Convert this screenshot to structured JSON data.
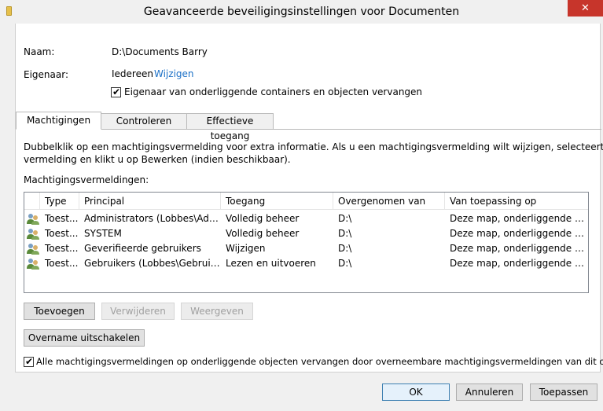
{
  "window": {
    "title": "Geavanceerde beveiligingsinstellingen voor Documenten",
    "close_label": "✕"
  },
  "owner": {
    "name_label": "Naam:",
    "name_value": "D:\\Documents Barry",
    "owner_label": "Eigenaar:",
    "owner_value": "Iedereen",
    "change_link": "Wijzigen",
    "replace_owner_label": "Eigenaar van onderliggende containers en objecten vervangen",
    "replace_owner_checked": true
  },
  "tabs": [
    {
      "label": "Machtigingen",
      "active": true
    },
    {
      "label": "Controleren",
      "active": false
    },
    {
      "label": "Effectieve toegang",
      "active": false
    }
  ],
  "permissions": {
    "instructions_line1": "Dubbelklik op een machtigingsvermelding voor extra informatie. Als u een machtigingsvermelding wilt wijzigen, selecteert u de",
    "instructions_line2": "vermelding en klikt u op Bewerken (indien beschikbaar).",
    "entries_label": "Machtigingsvermeldingen:",
    "columns": [
      "Type",
      "Principal",
      "Toegang",
      "Overgenomen van",
      "Van toepassing op"
    ],
    "rows": [
      {
        "type": "Toest...",
        "principal": "Administrators (Lobbes\\Admi...",
        "access": "Volledig beheer",
        "inherited": "D:\\",
        "applies": "Deze map, onderliggende map..."
      },
      {
        "type": "Toest...",
        "principal": "SYSTEM",
        "access": "Volledig beheer",
        "inherited": "D:\\",
        "applies": "Deze map, onderliggende map..."
      },
      {
        "type": "Toest...",
        "principal": "Geverifieerde gebruikers",
        "access": "Wijzigen",
        "inherited": "D:\\",
        "applies": "Deze map, onderliggende map..."
      },
      {
        "type": "Toest...",
        "principal": "Gebruikers (Lobbes\\Gebruikers)",
        "access": "Lezen en uitvoeren",
        "inherited": "D:\\",
        "applies": "Deze map, onderliggende map..."
      }
    ]
  },
  "actions": {
    "add": "Toevoegen",
    "remove": "Verwijderen",
    "view": "Weergeven",
    "disable_inheritance": "Overname uitschakelen",
    "replace_child_label": "Alle machtigingsvermeldingen op onderliggende objecten vervangen door overneembare machtigingsvermeldingen van dit object",
    "replace_child_checked": true
  },
  "footer": {
    "ok": "OK",
    "cancel": "Annuleren",
    "apply": "Toepassen"
  }
}
